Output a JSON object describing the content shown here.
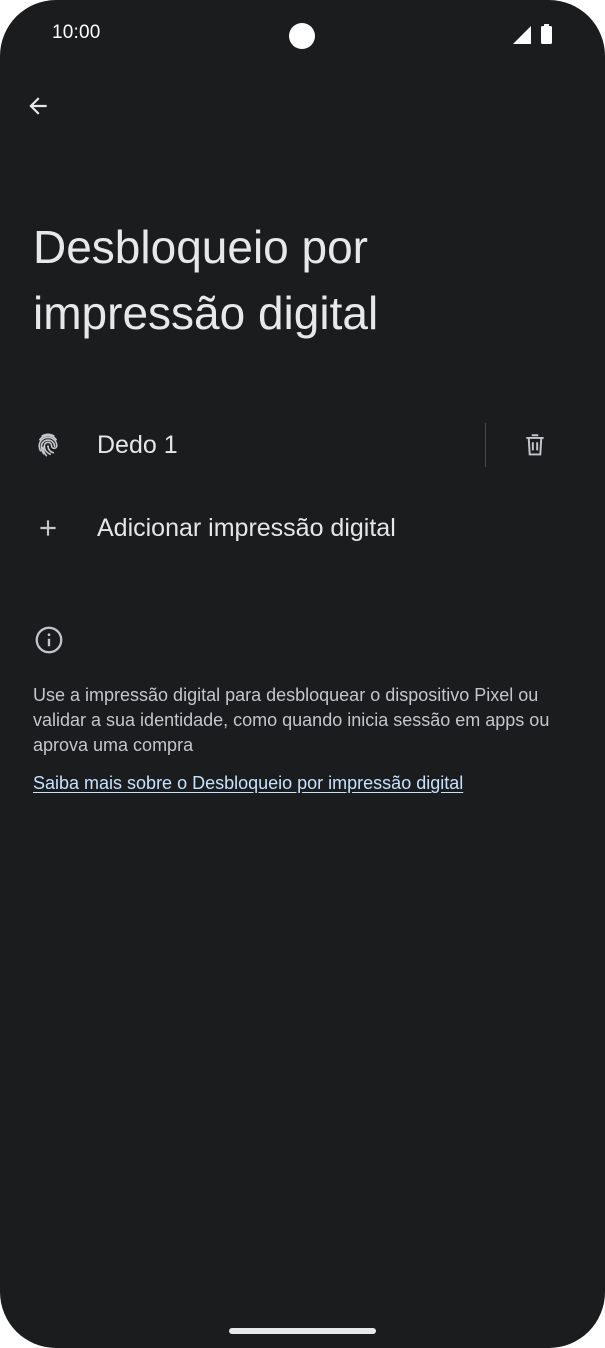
{
  "status_bar": {
    "time": "10:00",
    "icons": [
      "camera-cutout",
      "signal-icon",
      "battery-icon"
    ]
  },
  "header": {
    "back_icon": "arrow-back-icon",
    "title": "Desbloqueio por impressão digital"
  },
  "fingerprints": [
    {
      "icon": "fingerprint-icon",
      "label": "Dedo 1",
      "delete_icon": "trash-icon"
    }
  ],
  "add_fingerprint": {
    "icon": "plus-icon",
    "label": "Adicionar impressão digital"
  },
  "info": {
    "icon": "info-icon",
    "text": "Use a impressão digital para desbloquear o dispositivo Pixel ou validar a sua identidade, como quando inicia sessão em apps ou aprova uma compra",
    "link": "Saiba mais sobre o Desbloqueio por impressão digital"
  },
  "colors": {
    "background": "#1b1c1e",
    "text_primary": "#e6e6e8",
    "text_secondary": "#c4c6ca",
    "link": "#c6e2ff"
  }
}
